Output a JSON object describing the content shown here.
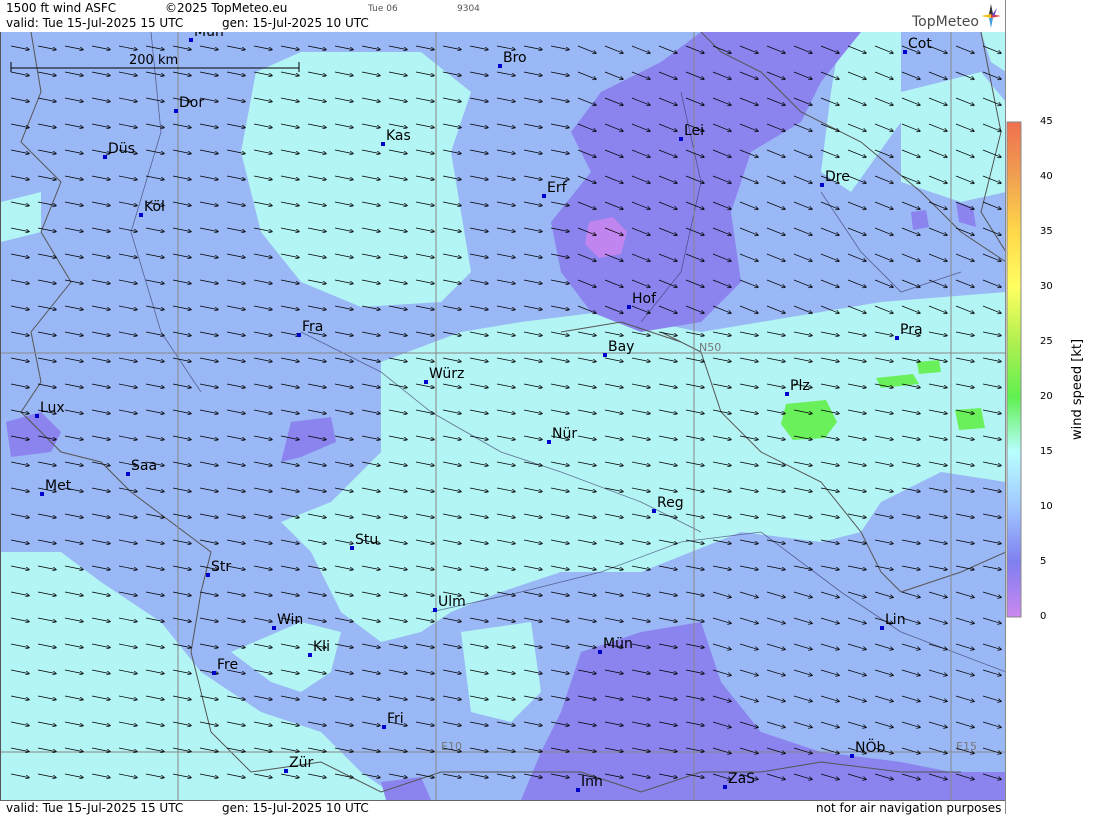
{
  "header": {
    "product": "1500 ft wind ASFC",
    "copyright": "©2025 TopMeteo.eu",
    "day_code": "Tue 06",
    "id_code": "9304",
    "valid": "valid:  Tue  15-Jul-2025  15 UTC",
    "generated": "gen: 15-Jul-2025 10 UTC",
    "brand": "TopMeteo"
  },
  "footer": {
    "valid": "valid:  Tue  15-Jul-2025  15 UTC",
    "generated": "gen: 15-Jul-2025 10 UTC",
    "disclaimer": "not for air navigation purposes"
  },
  "scale_bar": {
    "label": "200 km"
  },
  "grid_labels": {
    "lat": "N50",
    "lon1": "E10",
    "lon2": "E15"
  },
  "cities": [
    "Mün",
    "Bro",
    "Cot",
    "Dor",
    "Kas",
    "Lei",
    "Düs",
    "Erf",
    "Dre",
    "Köl",
    "Hof",
    "Fra",
    "Pra",
    "Bay",
    "Würz",
    "Plz",
    "Lux",
    "Nür",
    "Saa",
    "Met",
    "Reg",
    "Stu",
    "Str",
    "Ulm",
    "Win",
    "Lin",
    "Kli",
    "Mün",
    "Fre",
    "Fri",
    "NÖb",
    "Zür",
    "Inn",
    "ZaS"
  ],
  "legend": {
    "title": "wind  speed  [kt]",
    "ticks": [
      "45",
      "40",
      "35",
      "30",
      "25",
      "20",
      "15",
      "10",
      "5",
      "0"
    ],
    "colors": [
      "#f07050",
      "#f0a050",
      "#ffd84a",
      "#ffff60",
      "#b0f050",
      "#60f050",
      "#b8ffff",
      "#a0c8ff",
      "#7f7ff0",
      "#cc88f0"
    ]
  },
  "colors": {
    "bg_blue": "#9ab8f5",
    "light_cyan": "#b3f4f4",
    "violet": "#8b84ef",
    "purple": "#c085ee",
    "green": "#6af05a"
  }
}
